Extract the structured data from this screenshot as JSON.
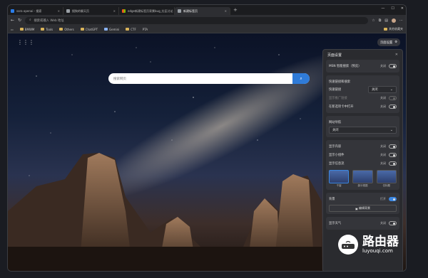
{
  "tabs": [
    {
      "label": "sora openai - 搜索",
      "color": "#2b7de9"
    },
    {
      "label": "搜狗的聊天页",
      "color": "#9aa0a6"
    },
    {
      "label": "edge新建标签页背景bug_社区讨论",
      "color": "#f25022"
    },
    {
      "label": "新建标签页",
      "color": "#9aa0a6"
    }
  ],
  "addr": {
    "placeholder": "搜索或输入 Web 地址"
  },
  "bookmarks": [
    "BMWM",
    "Tools",
    "Others",
    "ChatGPT",
    "Gemini",
    "CTF",
    "PTA"
  ],
  "bookmarks_right": "其他收藏夹",
  "search": {
    "placeholder": "搜索网页"
  },
  "page_settings_btn": "页面设置",
  "panel": {
    "title": "页面设置",
    "msn": {
      "label": "MSN 智能搜索（预览）",
      "state": "关闭"
    },
    "quick_header": "快速链接和搜索",
    "quick_links": {
      "label": "快速链接",
      "value": "关闭"
    },
    "promoted": {
      "label": "显示推广链接",
      "state": "关闭"
    },
    "open_new_tab": {
      "label": "在新选项卡中打开",
      "state": "关闭"
    },
    "nav_header": "网站导航",
    "nav_value": "关闭",
    "content_header": "显示内容",
    "content_state": "关闭",
    "widgets": {
      "label": "显示小组件",
      "state": "关闭"
    },
    "infoflow": {
      "label": "显示信息流",
      "state": "关闭"
    },
    "layouts": [
      "干窗",
      "部分视图",
      "仅标题"
    ],
    "bg": {
      "label": "背景",
      "state": "打开"
    },
    "edit_bg": "编辑背景",
    "weather": {
      "label": "显示天气",
      "state": "关闭"
    }
  },
  "watermark": {
    "title": "路由器",
    "url": "luyouqi.com"
  }
}
